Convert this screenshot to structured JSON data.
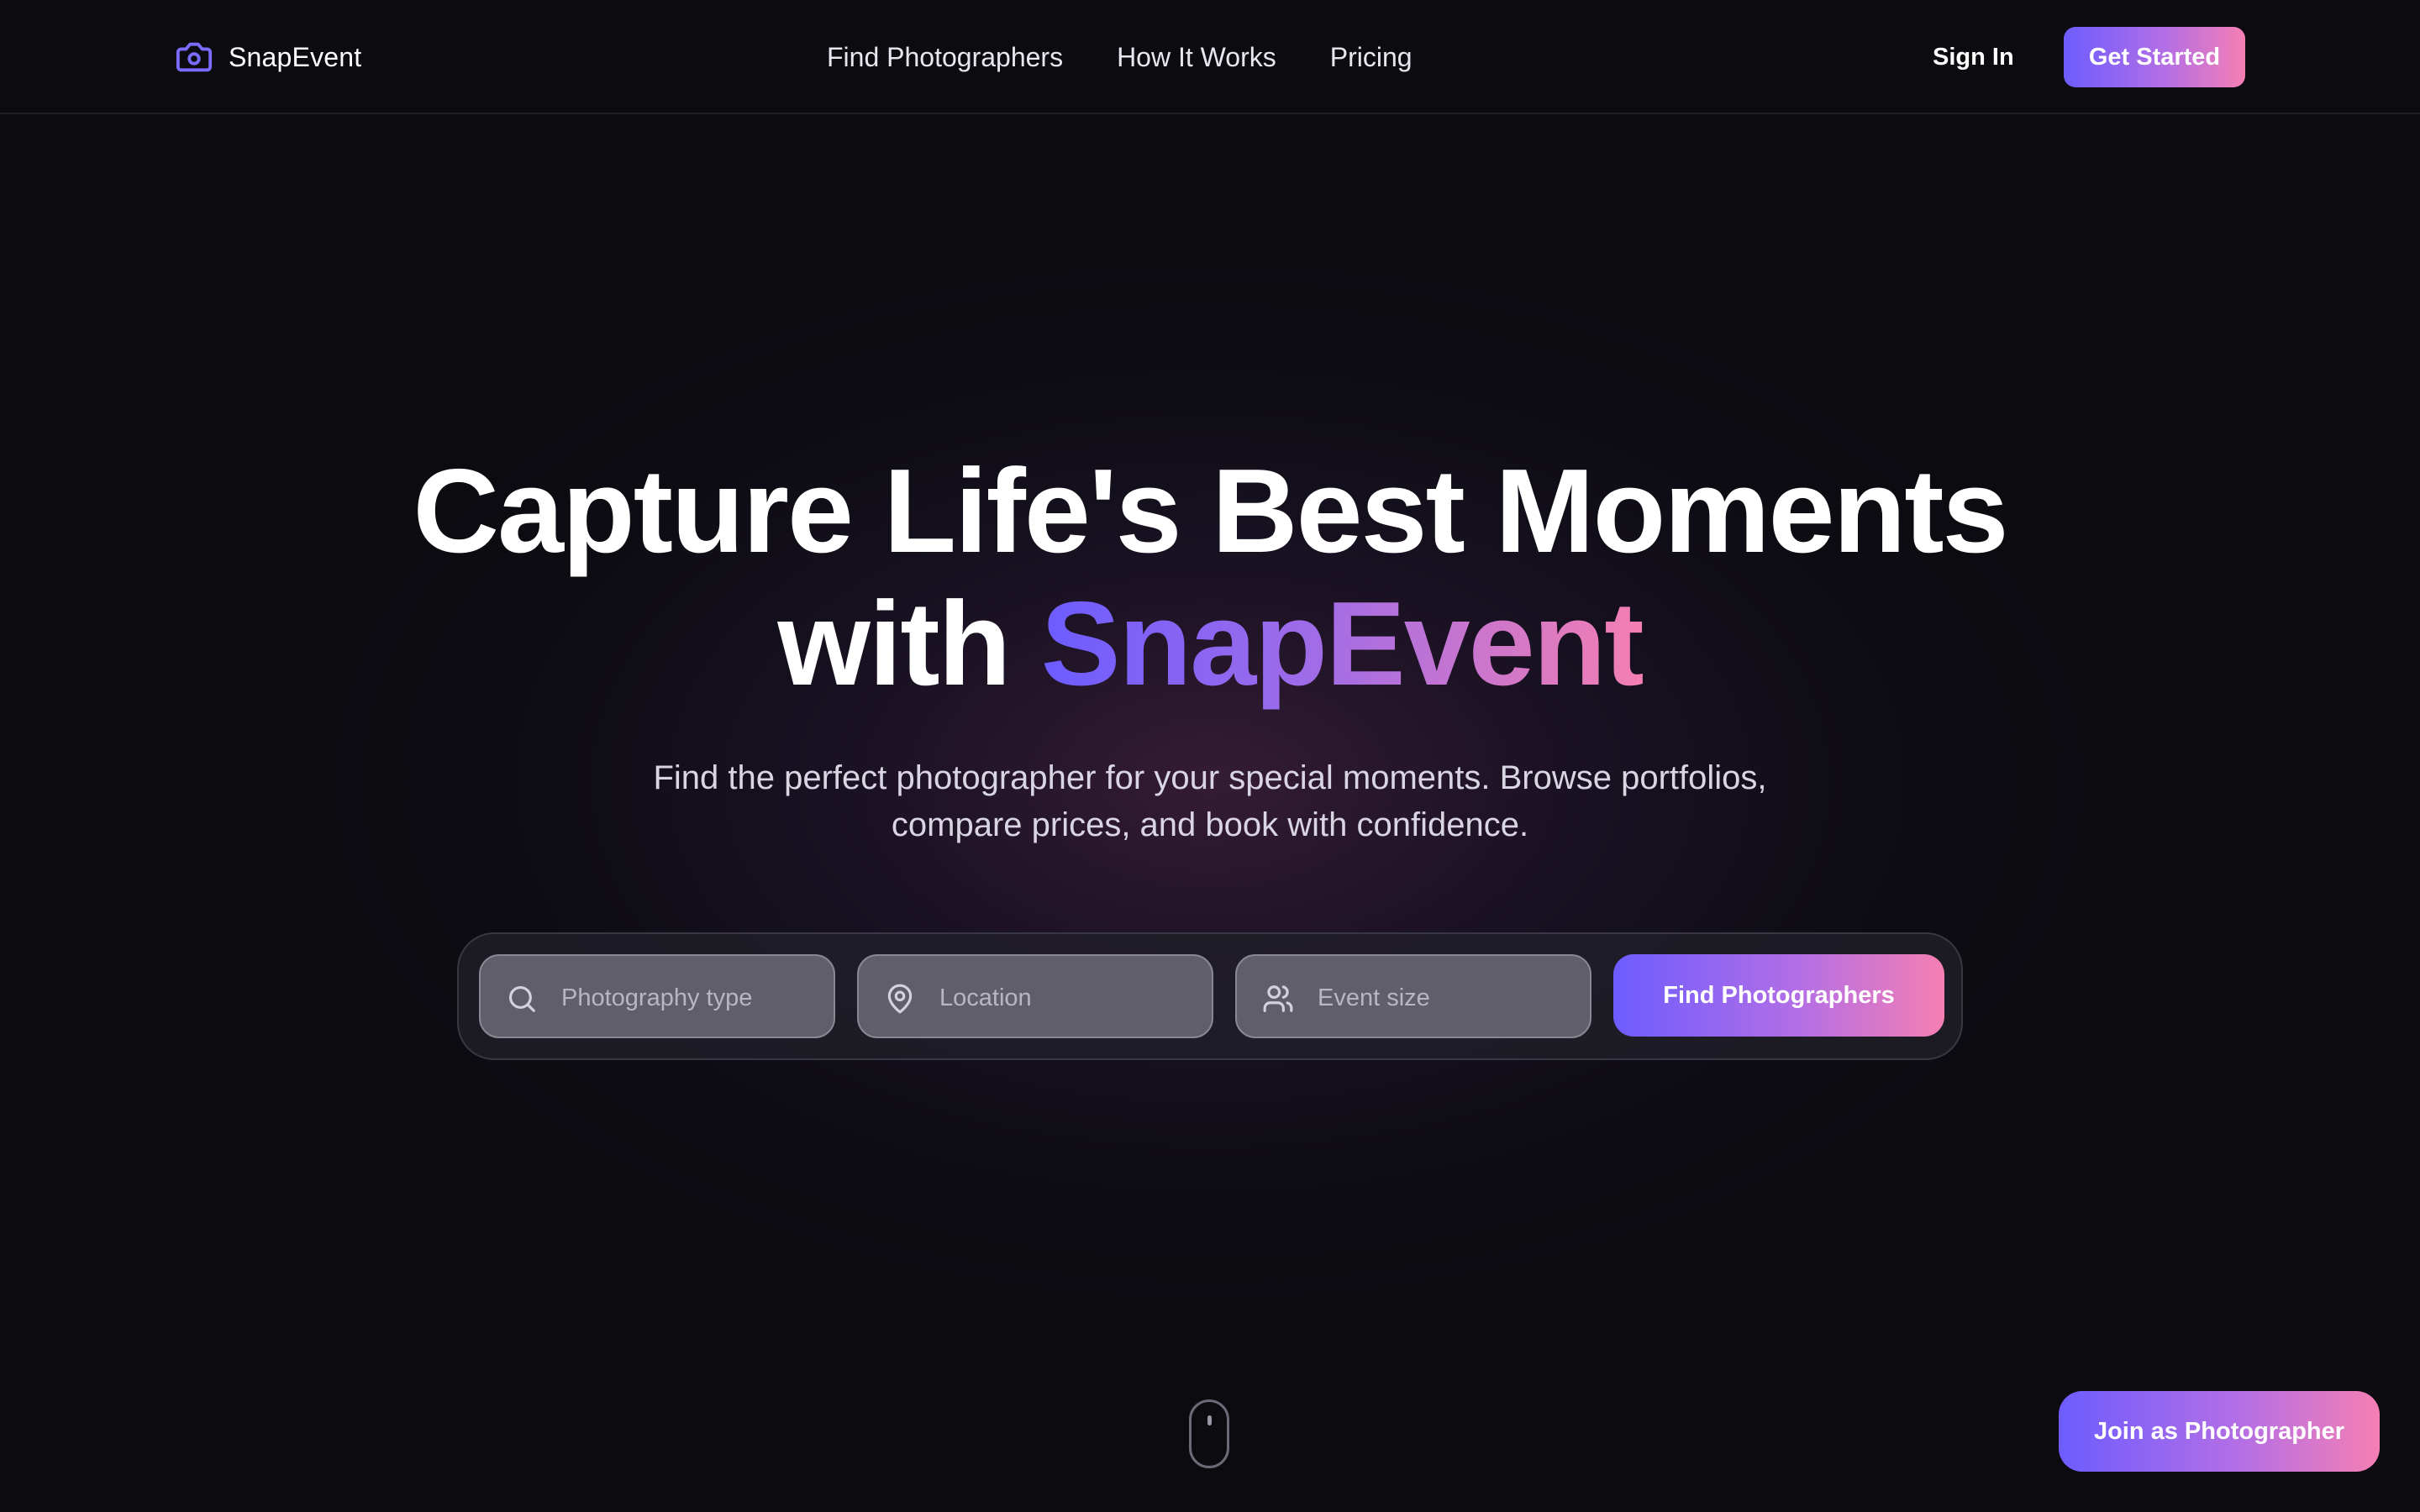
{
  "brand": {
    "name": "SnapEvent",
    "icon": "camera-icon"
  },
  "nav": {
    "links": [
      "Find Photographers",
      "How It Works",
      "Pricing"
    ],
    "sign_in": "Sign In",
    "get_started": "Get Started"
  },
  "hero": {
    "title_line1": "Capture Life's Best Moments",
    "title_with": "with",
    "title_brand": "SnapEvent",
    "subtitle_line1": "Find the perfect photographer for your special moments. Browse portfolios,",
    "subtitle_line2": "compare prices, and book with confidence."
  },
  "search": {
    "type_placeholder": "Photography type",
    "type_icon": "search-icon",
    "location_placeholder": "Location",
    "location_icon": "map-pin-icon",
    "size_placeholder": "Event size",
    "size_icon": "users-icon",
    "submit": "Find Photographers"
  },
  "floating": {
    "join": "Join as Photographer"
  },
  "colors": {
    "background": "#0b0b10",
    "accent_start": "#6d5cff",
    "accent_end": "#f57fb4"
  }
}
